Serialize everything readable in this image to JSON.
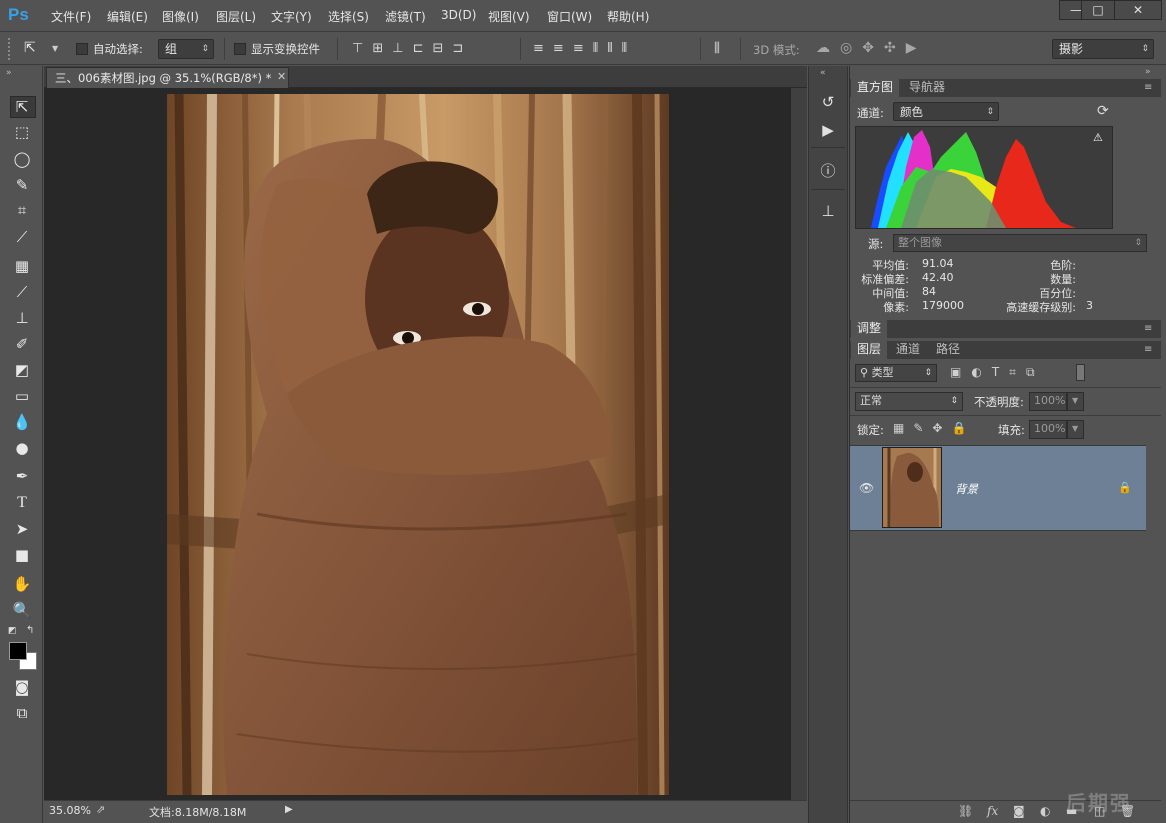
{
  "app": {
    "logo": "Ps"
  },
  "menu": [
    "文件(F)",
    "编辑(E)",
    "图像(I)",
    "图层(L)",
    "文字(Y)",
    "选择(S)",
    "滤镜(T)",
    "3D(D)",
    "视图(V)",
    "窗口(W)",
    "帮助(H)"
  ],
  "window_controls": {
    "minimize": "—",
    "maximize": "□",
    "close": "✕"
  },
  "options": {
    "auto_select_label": "自动选择:",
    "auto_select_value": "组",
    "show_transform_label": "显示变换控件",
    "mode_3d_label": "3D 模式:",
    "workspace": "摄影"
  },
  "document": {
    "tab_title": "三、006素材图.jpg @ 35.1%(RGB/8*) *",
    "zoom": "35.08%",
    "doc_size": "文档:8.18M/8.18M"
  },
  "histogram": {
    "tabs": [
      "直方图",
      "导航器"
    ],
    "channel_label": "通道:",
    "channel_value": "颜色",
    "source_label": "源:",
    "source_value": "整个图像",
    "stats": {
      "mean_label": "平均值:",
      "mean": "91.04",
      "std_label": "标准偏差:",
      "std": "42.40",
      "median_label": "中间值:",
      "median": "84",
      "pixels_label": "像素:",
      "pixels": "179000",
      "level_label": "色阶:",
      "count_label": "数量:",
      "percentile_label": "百分位:",
      "cache_label": "高速缓存级别:",
      "cache": "3"
    }
  },
  "adjust_panel": {
    "tab": "调整"
  },
  "layers_panel": {
    "tabs": [
      "图层",
      "通道",
      "路径"
    ],
    "filter_value": "类型",
    "blend_mode": "正常",
    "opacity_label": "不透明度:",
    "opacity_value": "100%",
    "lock_label": "锁定:",
    "fill_label": "填充:",
    "fill_value": "100%",
    "layers": [
      {
        "name": "背景",
        "visible": true,
        "locked": true
      }
    ]
  },
  "watermark": "后期强"
}
